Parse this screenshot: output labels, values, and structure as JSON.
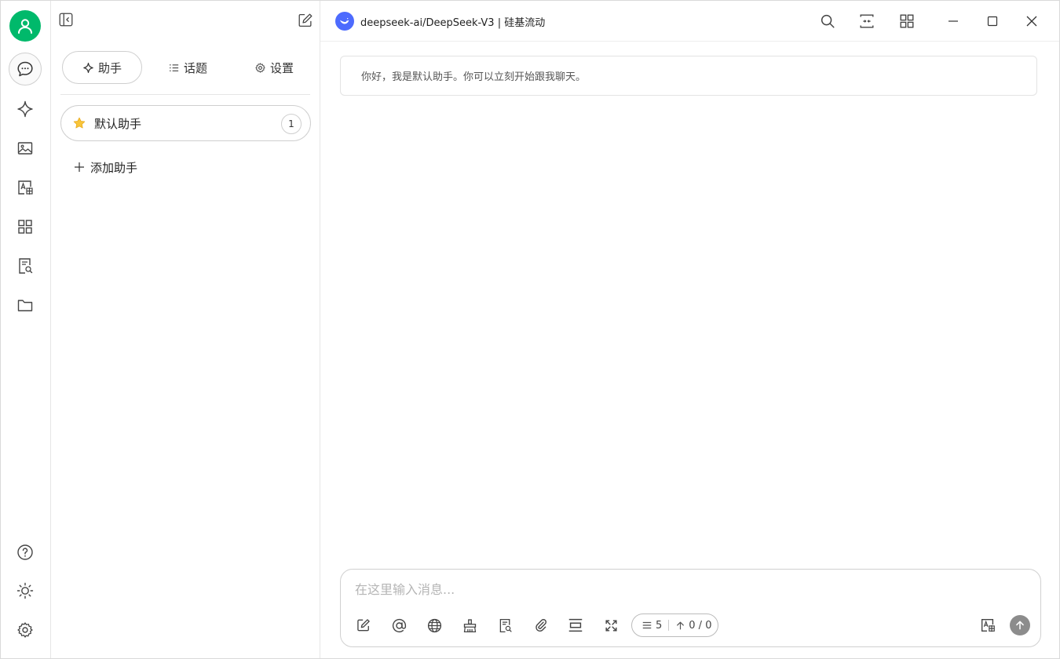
{
  "app": {
    "accent_color": "#00b96b",
    "model_logo_color": "#4d6bfe"
  },
  "rail": {
    "top_items": [
      {
        "name": "chat-icon",
        "active": true
      },
      {
        "name": "sparkle-icon"
      },
      {
        "name": "image-icon"
      },
      {
        "name": "translate-icon"
      },
      {
        "name": "apps-grid-icon"
      },
      {
        "name": "knowledge-search-icon"
      },
      {
        "name": "folder-icon"
      }
    ],
    "bottom_items": [
      {
        "name": "help-icon"
      },
      {
        "name": "sun-theme-icon"
      },
      {
        "name": "settings-gear-icon"
      }
    ]
  },
  "panel": {
    "tabs": [
      {
        "label": "助手",
        "icon": "sparkle-icon",
        "active": true
      },
      {
        "label": "话题",
        "icon": "list-icon"
      },
      {
        "label": "设置",
        "icon": "gear-icon"
      }
    ],
    "assistants": [
      {
        "label": "默认助手",
        "count": "1",
        "icon": "star-icon"
      }
    ],
    "add_assistant_label": "添加助手"
  },
  "titlebar": {
    "model_name": "deepseek-ai/DeepSeek-V3 | 硅基流动"
  },
  "chat": {
    "greeting": "你好，我是默认助手。你可以立刻开始跟我聊天。"
  },
  "composer": {
    "placeholder": "在这里输入消息...",
    "context_count": "5",
    "token_usage": "0 / 0"
  }
}
